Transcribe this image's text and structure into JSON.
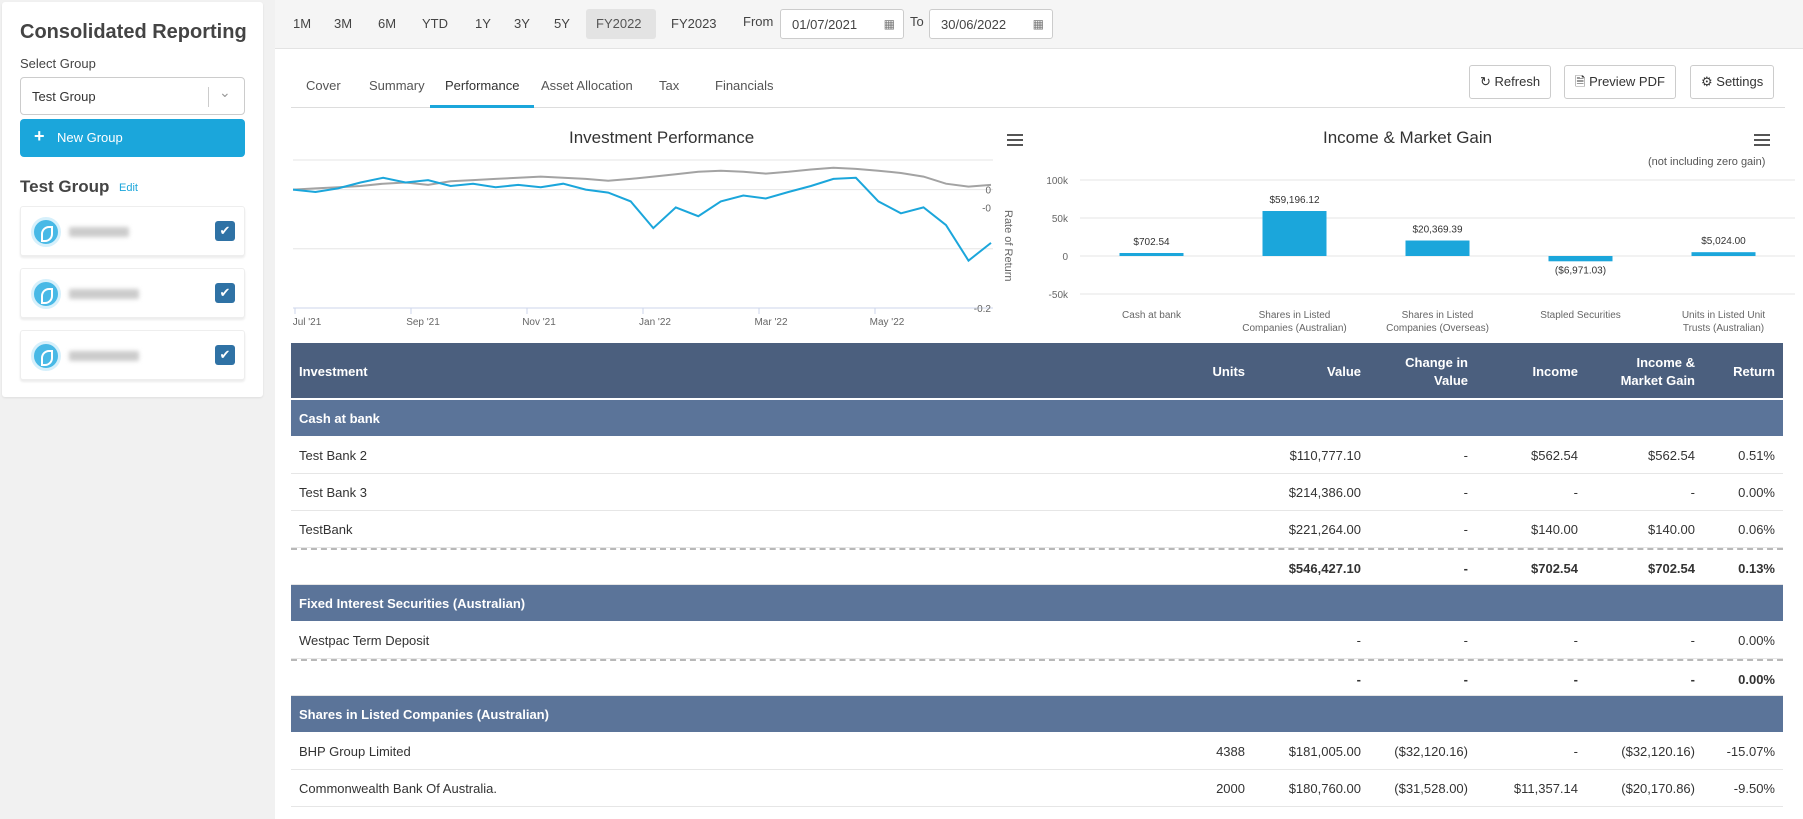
{
  "sidebar": {
    "title": "Consolidated Reporting",
    "select_label": "Select Group",
    "selected_group": "Test Group",
    "new_group_label": "New Group",
    "group_name": "Test Group",
    "edit_label": "Edit"
  },
  "toolbar": {
    "periods": [
      "1M",
      "3M",
      "6M",
      "YTD",
      "1Y",
      "3Y",
      "5Y",
      "FY2022",
      "FY2023"
    ],
    "active_period": "FY2022",
    "from_label": "From",
    "from_value": "01/07/2021",
    "to_label": "To",
    "to_value": "30/06/2022"
  },
  "tabs": [
    "Cover",
    "Summary",
    "Performance",
    "Asset Allocation",
    "Tax",
    "Financials"
  ],
  "active_tab": "Performance",
  "actions": {
    "refresh": "Refresh",
    "preview_pdf": "Preview PDF",
    "settings": "Settings"
  },
  "colors": {
    "accent": "#1ba6db",
    "header": "#4b5f7e",
    "group": "#5b7499",
    "grey_series": "#a3a3a3"
  },
  "chart_data": [
    {
      "type": "line",
      "title": "Investment Performance",
      "ylabel": "Rate of Return",
      "ylim": [
        -0.2,
        0.05
      ],
      "y_ticks": [
        "0",
        "-0",
        "-0.2"
      ],
      "x_ticks": [
        "Jul '21",
        "Sep '21",
        "Nov '21",
        "Jan '22",
        "Mar '22",
        "May '22"
      ],
      "series": [
        {
          "color": "#a3a3a3",
          "values": [
            0.0,
            0.002,
            0.004,
            0.006,
            0.01,
            0.012,
            0.008,
            0.014,
            0.016,
            0.018,
            0.02,
            0.022,
            0.02,
            0.018,
            0.015,
            0.018,
            0.022,
            0.026,
            0.03,
            0.032,
            0.03,
            0.027,
            0.03,
            0.034,
            0.037,
            0.035,
            0.032,
            0.028,
            0.022,
            0.01,
            0.005,
            0.008
          ]
        },
        {
          "color": "#1ba6db",
          "values": [
            0.0,
            -0.004,
            0.002,
            0.012,
            0.02,
            0.012,
            0.016,
            0.006,
            0.01,
            0.004,
            0.008,
            0.004,
            0.01,
            0.0,
            -0.005,
            -0.02,
            -0.065,
            -0.03,
            -0.045,
            -0.02,
            -0.01,
            -0.015,
            -0.004,
            0.006,
            0.018,
            0.02,
            -0.02,
            -0.04,
            -0.03,
            -0.06,
            -0.12,
            -0.09
          ]
        }
      ]
    },
    {
      "type": "bar",
      "title": "Income & Market Gain",
      "subtitle": "(not including zero gain)",
      "categories": [
        "Cash at bank",
        "Shares in Listed Companies (Australian)",
        "Shares in Listed Companies (Overseas)",
        "Stapled Securities",
        "Units in Listed Unit Trusts (Australian)"
      ],
      "values": [
        702.54,
        59196.12,
        20369.39,
        -6971.03,
        5024.0
      ],
      "labels": [
        "$702.54",
        "$59,196.12",
        "$20,369.39",
        "($6,971.03)",
        "$5,024.00"
      ],
      "y_ticks": [
        "100k",
        "50k",
        "0",
        "-50k"
      ],
      "ylim": [
        -50000,
        100000
      ]
    }
  ],
  "table": {
    "headers": [
      "Investment",
      "Units",
      "Value",
      "Change in Value",
      "Income",
      "Income & Market Gain",
      "Return"
    ],
    "rows": [
      {
        "type": "group",
        "name": "Cash at bank"
      },
      {
        "type": "item",
        "cells": [
          "Test Bank 2",
          "",
          "$110,777.10",
          "-",
          "$562.54",
          "$562.54",
          "0.51%"
        ]
      },
      {
        "type": "item",
        "cells": [
          "Test Bank 3",
          "",
          "$214,386.00",
          "-",
          "-",
          "-",
          "0.00%"
        ]
      },
      {
        "type": "item",
        "cells": [
          "TestBank",
          "",
          "$221,264.00",
          "-",
          "$140.00",
          "$140.00",
          "0.06%"
        ]
      },
      {
        "type": "total",
        "cells": [
          "",
          "",
          "$546,427.10",
          "-",
          "$702.54",
          "$702.54",
          "0.13%"
        ]
      },
      {
        "type": "group",
        "name": "Fixed Interest Securities (Australian)"
      },
      {
        "type": "item",
        "cells": [
          "Westpac Term Deposit",
          "",
          "-",
          "-",
          "-",
          "-",
          "0.00%"
        ]
      },
      {
        "type": "total",
        "cells": [
          "",
          "",
          "-",
          "-",
          "-",
          "-",
          "0.00%"
        ]
      },
      {
        "type": "group",
        "name": "Shares in Listed Companies (Australian)"
      },
      {
        "type": "item",
        "cells": [
          "BHP Group Limited",
          "4388",
          "$181,005.00",
          "($32,120.16)",
          "-",
          "($32,120.16)",
          "-15.07%"
        ]
      },
      {
        "type": "item",
        "cells": [
          "Commonwealth Bank Of Australia.",
          "2000",
          "$180,760.00",
          "($31,528.00)",
          "$11,357.14",
          "($20,170.86)",
          "-9.50%"
        ]
      }
    ]
  }
}
